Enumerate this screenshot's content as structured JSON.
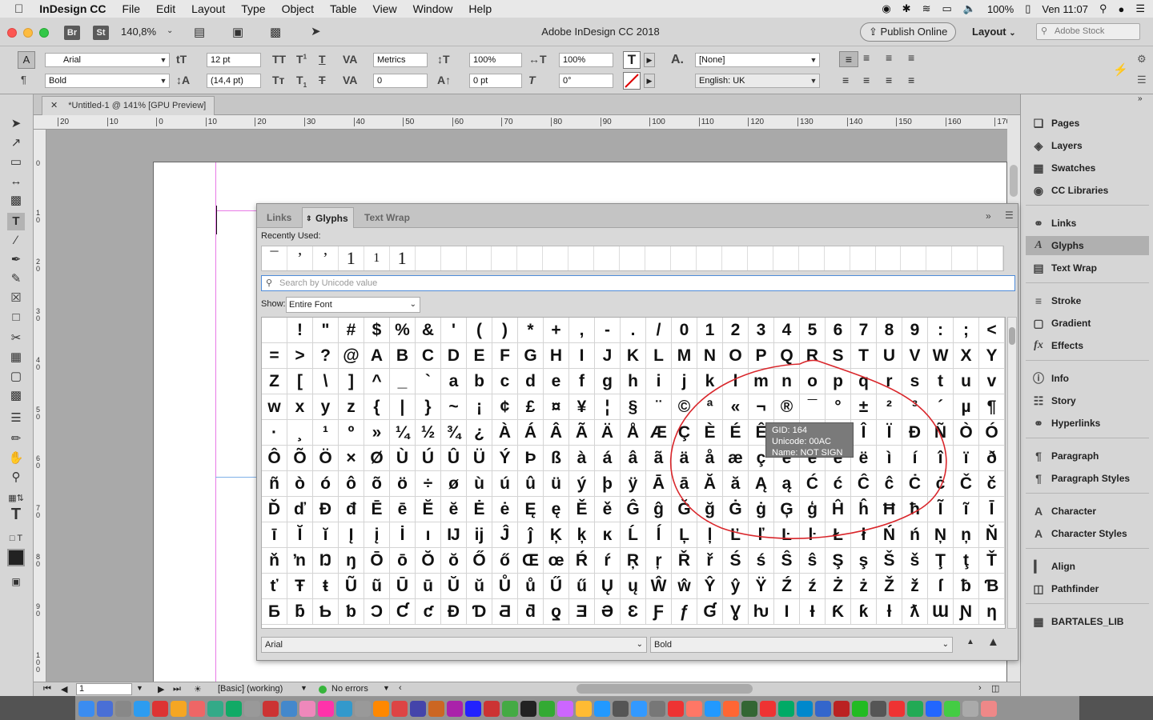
{
  "menubar": {
    "app_name": "InDesign CC",
    "items": [
      "File",
      "Edit",
      "Layout",
      "Type",
      "Object",
      "Table",
      "View",
      "Window",
      "Help"
    ],
    "battery": "100%",
    "clock": "Ven 11:07"
  },
  "appbar": {
    "br_label": "Br",
    "st_label": "St",
    "zoom": "140,8%",
    "title": "Adobe InDesign CC 2018",
    "publish_label": "Publish Online",
    "workspace": "Layout",
    "stock_placeholder": "Adobe Stock"
  },
  "control": {
    "font_family": "Arial",
    "font_style": "Bold",
    "font_size": "12 pt",
    "leading": "(14,4 pt)",
    "kerning": "Metrics",
    "tracking": "0",
    "vscale": "100%",
    "hscale": "100%",
    "baseline": "0 pt",
    "skew": "0°",
    "char_style": "[None]",
    "language": "English: UK"
  },
  "document": {
    "tab_title": "*Untitled-1 @ 141% [GPU Preview]"
  },
  "ruler": {
    "h_ticks": [
      "20",
      "10",
      "0",
      "10",
      "20",
      "30",
      "40",
      "50",
      "60",
      "70",
      "80",
      "90",
      "100",
      "110",
      "120",
      "130",
      "140",
      "150",
      "160",
      "170"
    ],
    "v_ticks": [
      "0",
      "1\n0",
      "2\n0",
      "3\n0",
      "4\n0",
      "5\n0",
      "6\n0",
      "7\n0",
      "8\n0",
      "9\n0",
      "1\n0\n0"
    ]
  },
  "status": {
    "page": "1",
    "profile": "[Basic] (working)",
    "errors": "No errors"
  },
  "glyph_panel": {
    "tabs": [
      "Links",
      "Glyphs",
      "Text Wrap"
    ],
    "recently_used_label": "Recently Used:",
    "recent": [
      "¯",
      "’",
      "’",
      "1",
      "1",
      "1"
    ],
    "search_placeholder": "Search by Unicode value",
    "show_label": "Show:",
    "show_value": "Entire Font",
    "font": "Arial",
    "style": "Bold",
    "glyphs": [
      " ",
      "!",
      "\"",
      "#",
      "$",
      "%",
      "&",
      "'",
      "(",
      ")",
      "*",
      "+",
      ",",
      "-",
      ".",
      "/",
      "0",
      "1",
      "2",
      "3",
      "4",
      "5",
      "6",
      "7",
      "8",
      "9",
      ":",
      ";",
      "<",
      "=",
      ">",
      "?",
      "@",
      "A",
      "B",
      "C",
      "D",
      "E",
      "F",
      "G",
      "H",
      "I",
      "J",
      "K",
      "L",
      "M",
      "N",
      "O",
      "P",
      "Q",
      "R",
      "S",
      "T",
      "U",
      "V",
      "W",
      "X",
      "Y",
      "Z",
      "[",
      "\\",
      "]",
      "^",
      "_",
      "`",
      "a",
      "b",
      "c",
      "d",
      "e",
      "f",
      "g",
      "h",
      "i",
      "j",
      "k",
      "l",
      "m",
      "n",
      "o",
      "p",
      "q",
      "r",
      "s",
      "t",
      "u",
      "v",
      "w",
      "x",
      "y",
      "z",
      "{",
      "|",
      "}",
      "~",
      "¡",
      "¢",
      "£",
      "¤",
      "¥",
      "¦",
      "§",
      "¨",
      "©",
      "ª",
      "«",
      "¬",
      "®",
      "¯",
      "°",
      "±",
      "²",
      "³",
      "´",
      "µ",
      "¶",
      "·",
      "¸",
      "¹",
      "º",
      "»",
      "¼",
      "½",
      "¾",
      "¿",
      "À",
      "Á",
      "Â",
      "Ã",
      "Ä",
      "Å",
      "Æ",
      "Ç",
      "È",
      "É",
      "Ê",
      "Ë",
      "Ì",
      "Í",
      "Î",
      "Ï",
      "Ð",
      "Ñ",
      "Ò",
      "Ó",
      "Ô",
      "Õ",
      "Ö",
      "×",
      "Ø",
      "Ù",
      "Ú",
      "Û",
      "Ü",
      "Ý",
      "Þ",
      "ß",
      "à",
      "á",
      "â",
      "ã",
      "ä",
      "å",
      "æ",
      "ç",
      "è",
      "é",
      "ê",
      "ë",
      "ì",
      "í",
      "î",
      "ï",
      "ð",
      "ñ",
      "ò",
      "ó",
      "ô",
      "õ",
      "ö",
      "÷",
      "ø",
      "ù",
      "ú",
      "û",
      "ü",
      "ý",
      "þ",
      "ÿ",
      "Ā",
      "ā",
      "Ă",
      "ă",
      "Ą",
      "ą",
      "Ć",
      "ć",
      "Ĉ",
      "ĉ",
      "Ċ",
      "ċ",
      "Č",
      "č",
      "Ď",
      "ď",
      "Đ",
      "đ",
      "Ē",
      "ē",
      "Ĕ",
      "ĕ",
      "Ė",
      "ė",
      "Ę",
      "ę",
      "Ě",
      "ě",
      "Ĝ",
      "ĝ",
      "Ğ",
      "ğ",
      "Ġ",
      "ġ",
      "Ģ",
      "ģ",
      "Ĥ",
      "ĥ",
      "Ħ",
      "ħ",
      "Ĩ",
      "ĩ",
      "Ī",
      "ī",
      "Ĭ",
      "ĭ",
      "Į",
      "į",
      "İ",
      "ı",
      "Ĳ",
      "ĳ",
      "Ĵ",
      "ĵ",
      "Ķ",
      "ķ",
      "ĸ",
      "Ĺ",
      "ĺ",
      "Ļ",
      "ļ",
      "Ľ",
      "ľ",
      "Ŀ",
      "ŀ",
      "Ł",
      "ł",
      "Ń",
      "ń",
      "Ņ",
      "ņ",
      "Ň",
      "ň",
      "ŉ",
      "Ŋ",
      "ŋ",
      "Ō",
      "ō",
      "Ŏ",
      "ŏ",
      "Ő",
      "ő",
      "Œ",
      "œ",
      "Ŕ",
      "ŕ",
      "Ŗ",
      "ŗ",
      "Ř",
      "ř",
      "Ś",
      "ś",
      "Ŝ",
      "ŝ",
      "Ş",
      "ş",
      "Š",
      "š",
      "Ţ",
      "ţ",
      "Ť",
      "ť",
      "Ŧ",
      "ŧ",
      "Ũ",
      "ũ",
      "Ū",
      "ū",
      "Ŭ",
      "ŭ",
      "Ů",
      "ů",
      "Ű",
      "ű",
      "Ų",
      "ų",
      "Ŵ",
      "ŵ",
      "Ŷ",
      "ŷ",
      "Ÿ",
      "Ź",
      "ź",
      "Ż",
      "ż",
      "Ž",
      "ž",
      "ſ",
      "ƀ",
      "Ɓ",
      "Ƃ",
      "ƃ",
      "Ƅ",
      "ƅ",
      "Ɔ",
      "Ƈ",
      "ƈ",
      "Ɖ",
      "Ɗ",
      "Ƌ",
      "ƌ",
      "ƍ",
      "Ǝ",
      "Ə",
      "Ɛ",
      "Ƒ",
      "ƒ",
      "Ɠ",
      "Ɣ",
      "ƕ",
      "Ɩ",
      "Ɨ",
      "Ƙ",
      "ƙ",
      "ƚ",
      "ƛ",
      "Ɯ",
      "Ɲ",
      "ƞ"
    ],
    "tooltip": {
      "gid": "GID: 164",
      "unicode": "Unicode: 00AC",
      "name": "Name: NOT SIGN"
    }
  },
  "right_panel": {
    "items": [
      "Pages",
      "Layers",
      "Swatches",
      "CC Libraries",
      "Links",
      "Glyphs",
      "Text Wrap",
      "Stroke",
      "Gradient",
      "Effects",
      "Info",
      "Story",
      "Hyperlinks",
      "Paragraph",
      "Paragraph Styles",
      "Character",
      "Character Styles",
      "Align",
      "Pathfinder",
      "BARTALES_LIB"
    ]
  },
  "colors": {
    "accent_blue": "#4f8bd8",
    "annotation_red": "#d9262b",
    "selected_row": "#b0b0b0"
  }
}
